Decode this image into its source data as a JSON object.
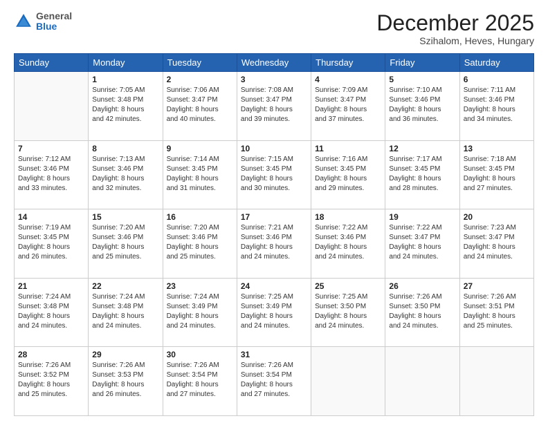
{
  "logo": {
    "general": "General",
    "blue": "Blue"
  },
  "header": {
    "month": "December 2025",
    "location": "Szihalom, Heves, Hungary"
  },
  "days": [
    "Sunday",
    "Monday",
    "Tuesday",
    "Wednesday",
    "Thursday",
    "Friday",
    "Saturday"
  ],
  "weeks": [
    [
      {
        "day": "",
        "content": ""
      },
      {
        "day": "1",
        "content": "Sunrise: 7:05 AM\nSunset: 3:48 PM\nDaylight: 8 hours\nand 42 minutes."
      },
      {
        "day": "2",
        "content": "Sunrise: 7:06 AM\nSunset: 3:47 PM\nDaylight: 8 hours\nand 40 minutes."
      },
      {
        "day": "3",
        "content": "Sunrise: 7:08 AM\nSunset: 3:47 PM\nDaylight: 8 hours\nand 39 minutes."
      },
      {
        "day": "4",
        "content": "Sunrise: 7:09 AM\nSunset: 3:47 PM\nDaylight: 8 hours\nand 37 minutes."
      },
      {
        "day": "5",
        "content": "Sunrise: 7:10 AM\nSunset: 3:46 PM\nDaylight: 8 hours\nand 36 minutes."
      },
      {
        "day": "6",
        "content": "Sunrise: 7:11 AM\nSunset: 3:46 PM\nDaylight: 8 hours\nand 34 minutes."
      }
    ],
    [
      {
        "day": "7",
        "content": "Sunrise: 7:12 AM\nSunset: 3:46 PM\nDaylight: 8 hours\nand 33 minutes."
      },
      {
        "day": "8",
        "content": "Sunrise: 7:13 AM\nSunset: 3:46 PM\nDaylight: 8 hours\nand 32 minutes."
      },
      {
        "day": "9",
        "content": "Sunrise: 7:14 AM\nSunset: 3:45 PM\nDaylight: 8 hours\nand 31 minutes."
      },
      {
        "day": "10",
        "content": "Sunrise: 7:15 AM\nSunset: 3:45 PM\nDaylight: 8 hours\nand 30 minutes."
      },
      {
        "day": "11",
        "content": "Sunrise: 7:16 AM\nSunset: 3:45 PM\nDaylight: 8 hours\nand 29 minutes."
      },
      {
        "day": "12",
        "content": "Sunrise: 7:17 AM\nSunset: 3:45 PM\nDaylight: 8 hours\nand 28 minutes."
      },
      {
        "day": "13",
        "content": "Sunrise: 7:18 AM\nSunset: 3:45 PM\nDaylight: 8 hours\nand 27 minutes."
      }
    ],
    [
      {
        "day": "14",
        "content": "Sunrise: 7:19 AM\nSunset: 3:45 PM\nDaylight: 8 hours\nand 26 minutes."
      },
      {
        "day": "15",
        "content": "Sunrise: 7:20 AM\nSunset: 3:46 PM\nDaylight: 8 hours\nand 25 minutes."
      },
      {
        "day": "16",
        "content": "Sunrise: 7:20 AM\nSunset: 3:46 PM\nDaylight: 8 hours\nand 25 minutes."
      },
      {
        "day": "17",
        "content": "Sunrise: 7:21 AM\nSunset: 3:46 PM\nDaylight: 8 hours\nand 24 minutes."
      },
      {
        "day": "18",
        "content": "Sunrise: 7:22 AM\nSunset: 3:46 PM\nDaylight: 8 hours\nand 24 minutes."
      },
      {
        "day": "19",
        "content": "Sunrise: 7:22 AM\nSunset: 3:47 PM\nDaylight: 8 hours\nand 24 minutes."
      },
      {
        "day": "20",
        "content": "Sunrise: 7:23 AM\nSunset: 3:47 PM\nDaylight: 8 hours\nand 24 minutes."
      }
    ],
    [
      {
        "day": "21",
        "content": "Sunrise: 7:24 AM\nSunset: 3:48 PM\nDaylight: 8 hours\nand 24 minutes."
      },
      {
        "day": "22",
        "content": "Sunrise: 7:24 AM\nSunset: 3:48 PM\nDaylight: 8 hours\nand 24 minutes."
      },
      {
        "day": "23",
        "content": "Sunrise: 7:24 AM\nSunset: 3:49 PM\nDaylight: 8 hours\nand 24 minutes."
      },
      {
        "day": "24",
        "content": "Sunrise: 7:25 AM\nSunset: 3:49 PM\nDaylight: 8 hours\nand 24 minutes."
      },
      {
        "day": "25",
        "content": "Sunrise: 7:25 AM\nSunset: 3:50 PM\nDaylight: 8 hours\nand 24 minutes."
      },
      {
        "day": "26",
        "content": "Sunrise: 7:26 AM\nSunset: 3:50 PM\nDaylight: 8 hours\nand 24 minutes."
      },
      {
        "day": "27",
        "content": "Sunrise: 7:26 AM\nSunset: 3:51 PM\nDaylight: 8 hours\nand 25 minutes."
      }
    ],
    [
      {
        "day": "28",
        "content": "Sunrise: 7:26 AM\nSunset: 3:52 PM\nDaylight: 8 hours\nand 25 minutes."
      },
      {
        "day": "29",
        "content": "Sunrise: 7:26 AM\nSunset: 3:53 PM\nDaylight: 8 hours\nand 26 minutes."
      },
      {
        "day": "30",
        "content": "Sunrise: 7:26 AM\nSunset: 3:54 PM\nDaylight: 8 hours\nand 27 minutes."
      },
      {
        "day": "31",
        "content": "Sunrise: 7:26 AM\nSunset: 3:54 PM\nDaylight: 8 hours\nand 27 minutes."
      },
      {
        "day": "",
        "content": ""
      },
      {
        "day": "",
        "content": ""
      },
      {
        "day": "",
        "content": ""
      }
    ]
  ]
}
